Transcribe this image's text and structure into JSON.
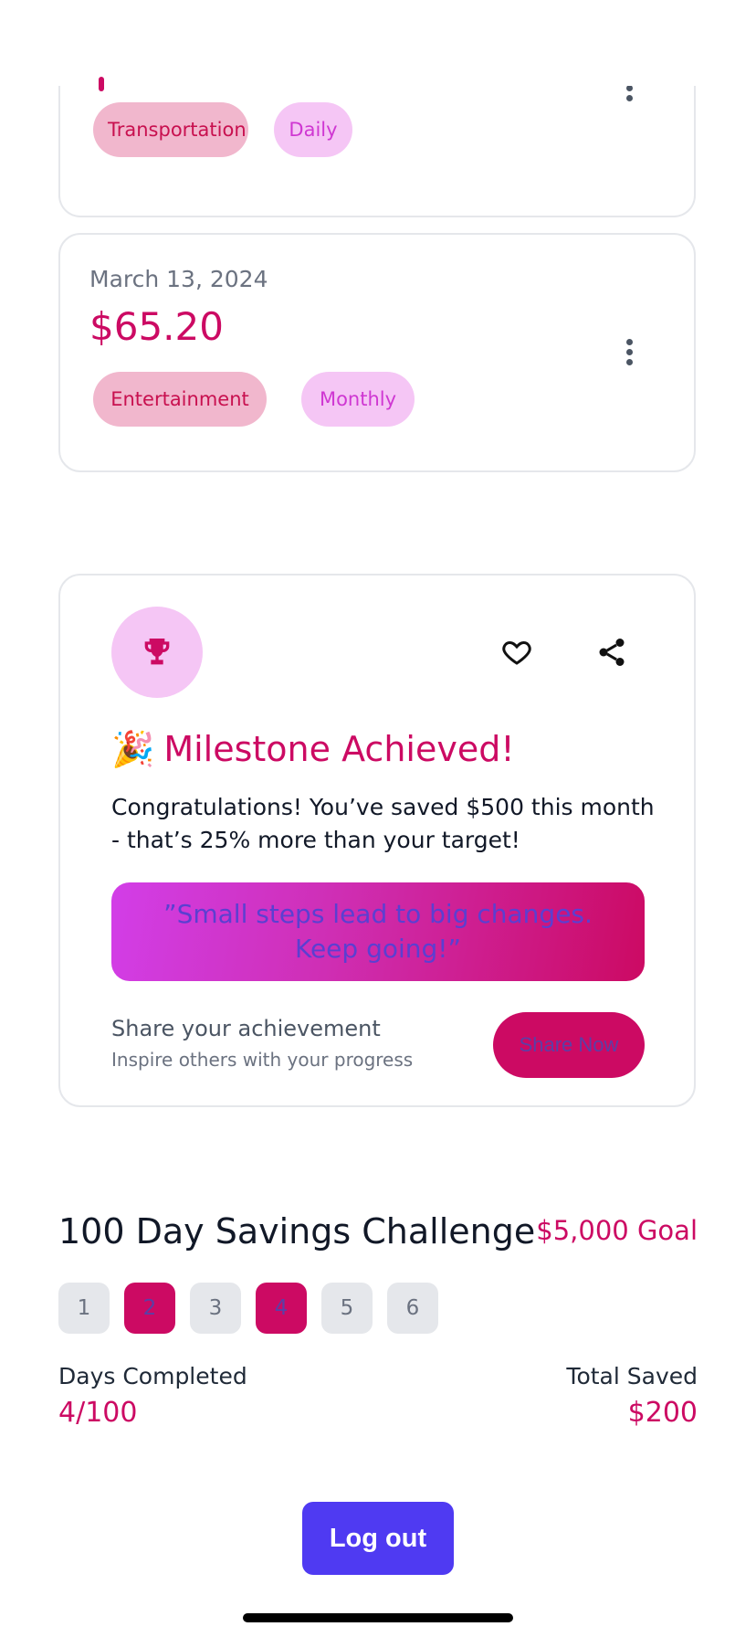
{
  "expenses": [
    {
      "date": "",
      "amount": "",
      "category": "Transportation",
      "frequency": "Daily"
    },
    {
      "date": "March 13, 2024",
      "amount": "$65.20",
      "category": "Entertainment",
      "frequency": "Monthly"
    }
  ],
  "milestone": {
    "emoji": "🎉",
    "title": "Milestone Achieved!",
    "message": "Congratulations! You’ve saved $500 this month - that’s 25% more than your target!",
    "quote": "”Small steps lead to big changes. Keep going!”",
    "share_title": "Share your achievement",
    "share_subtitle": "Inspire others with your progress",
    "share_button": "Share Now",
    "icons": {
      "badge": "trophy-icon",
      "like": "heart-icon",
      "share": "share-icon"
    }
  },
  "challenge": {
    "title": "100 Day Savings Challenge",
    "goal": "$5,000 Goal",
    "days": [
      {
        "label": "1",
        "done": false
      },
      {
        "label": "2",
        "done": true
      },
      {
        "label": "3",
        "done": false
      },
      {
        "label": "4",
        "done": true
      },
      {
        "label": "5",
        "done": false
      },
      {
        "label": "6",
        "done": false
      }
    ],
    "days_completed_label": "Days Completed",
    "days_completed_value": "4/100",
    "total_saved_label": "Total Saved",
    "total_saved_value": "$200"
  },
  "logout_label": "Log out",
  "colors": {
    "accent": "#cc0a63",
    "primary_button": "#4f3af2",
    "category_tag_bg": "#f1b7cd",
    "frequency_tag_bg": "#f5c6f5"
  }
}
